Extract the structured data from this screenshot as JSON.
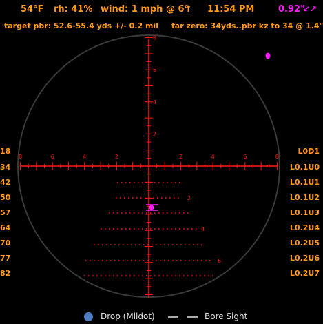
{
  "header": {
    "temp": "54°F",
    "rh": "rh: 41%",
    "wind": "wind: 1 mph @ 6°",
    "wind_arrow": "↑",
    "time": "11:54 PM",
    "offset": "0.92\"",
    "offset_icon": "↙↗"
  },
  "subheader": {
    "target": "target pbr: 52.6-55.4 yds  +/- 0.2 mil",
    "far_zero": "far zero: 34yds..pbr kz to 34 @ 1.4\""
  },
  "left_ranges": [
    "18",
    "34",
    "42",
    "50",
    "57",
    "64",
    "70",
    "77",
    "82"
  ],
  "right_labels": [
    "L0D1",
    "L0.1U0",
    "L0.1U1",
    "L0.1U2",
    "L0.1U3",
    "L0.2U4",
    "L0.2U5",
    "L0.2U6",
    "L0.2U7"
  ],
  "reticle": {
    "h_ticks": [
      "8",
      "6",
      "4",
      "2",
      "2",
      "4",
      "6",
      "8"
    ],
    "v_ticks": [
      "8",
      "6",
      "4",
      "2"
    ],
    "drop_labels": [
      "2",
      "4",
      "6"
    ],
    "colors": {
      "reticle": "#ff1a1a",
      "accent": "#ff1aff",
      "text": "#ff9a1f",
      "ring": "#3a3a3a"
    }
  },
  "legend": {
    "drop_label": "Drop (Mildot)",
    "bore_label": "Bore Sight"
  }
}
